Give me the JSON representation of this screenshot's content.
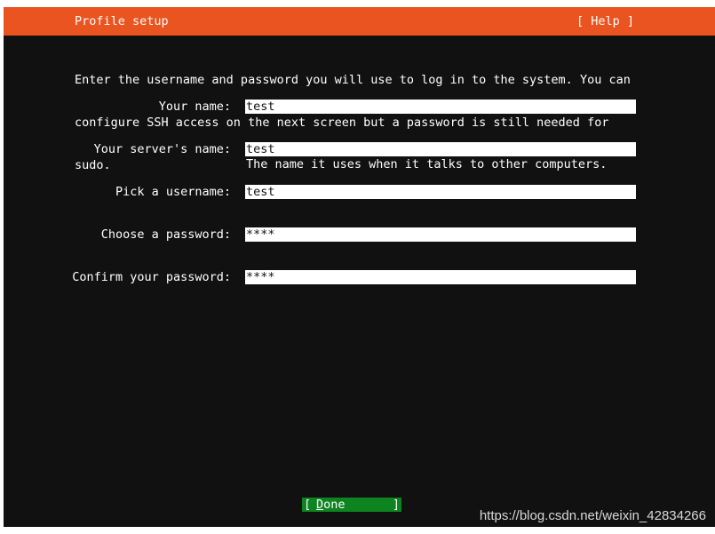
{
  "header": {
    "title": "Profile setup",
    "help_label": "[ Help ]"
  },
  "intro": {
    "lines": [
      "Enter the username and password you will use to log in to the system. You can",
      "configure SSH access on the next screen but a password is still needed for",
      "sudo."
    ]
  },
  "form": {
    "your_name": {
      "label": "Your name:",
      "value": "test"
    },
    "server_name": {
      "label": "Your server's name:",
      "value": "test",
      "help": "The name it uses when it talks to other computers."
    },
    "username": {
      "label": "Pick a username:",
      "value": "test"
    },
    "password": {
      "label": "Choose a password:",
      "value": "****"
    },
    "confirm_password": {
      "label": "Confirm your password:",
      "value": "****"
    }
  },
  "footer": {
    "done_open": "[",
    "done_hotkey": "D",
    "done_rest": "one",
    "done_close": "]"
  },
  "watermark": "https://blog.csdn.net/weixin_42834266",
  "colors": {
    "header_bg": "#e95420",
    "screen_bg": "#111111",
    "done_bg": "#0e8420",
    "input_bg": "#ffffff"
  }
}
